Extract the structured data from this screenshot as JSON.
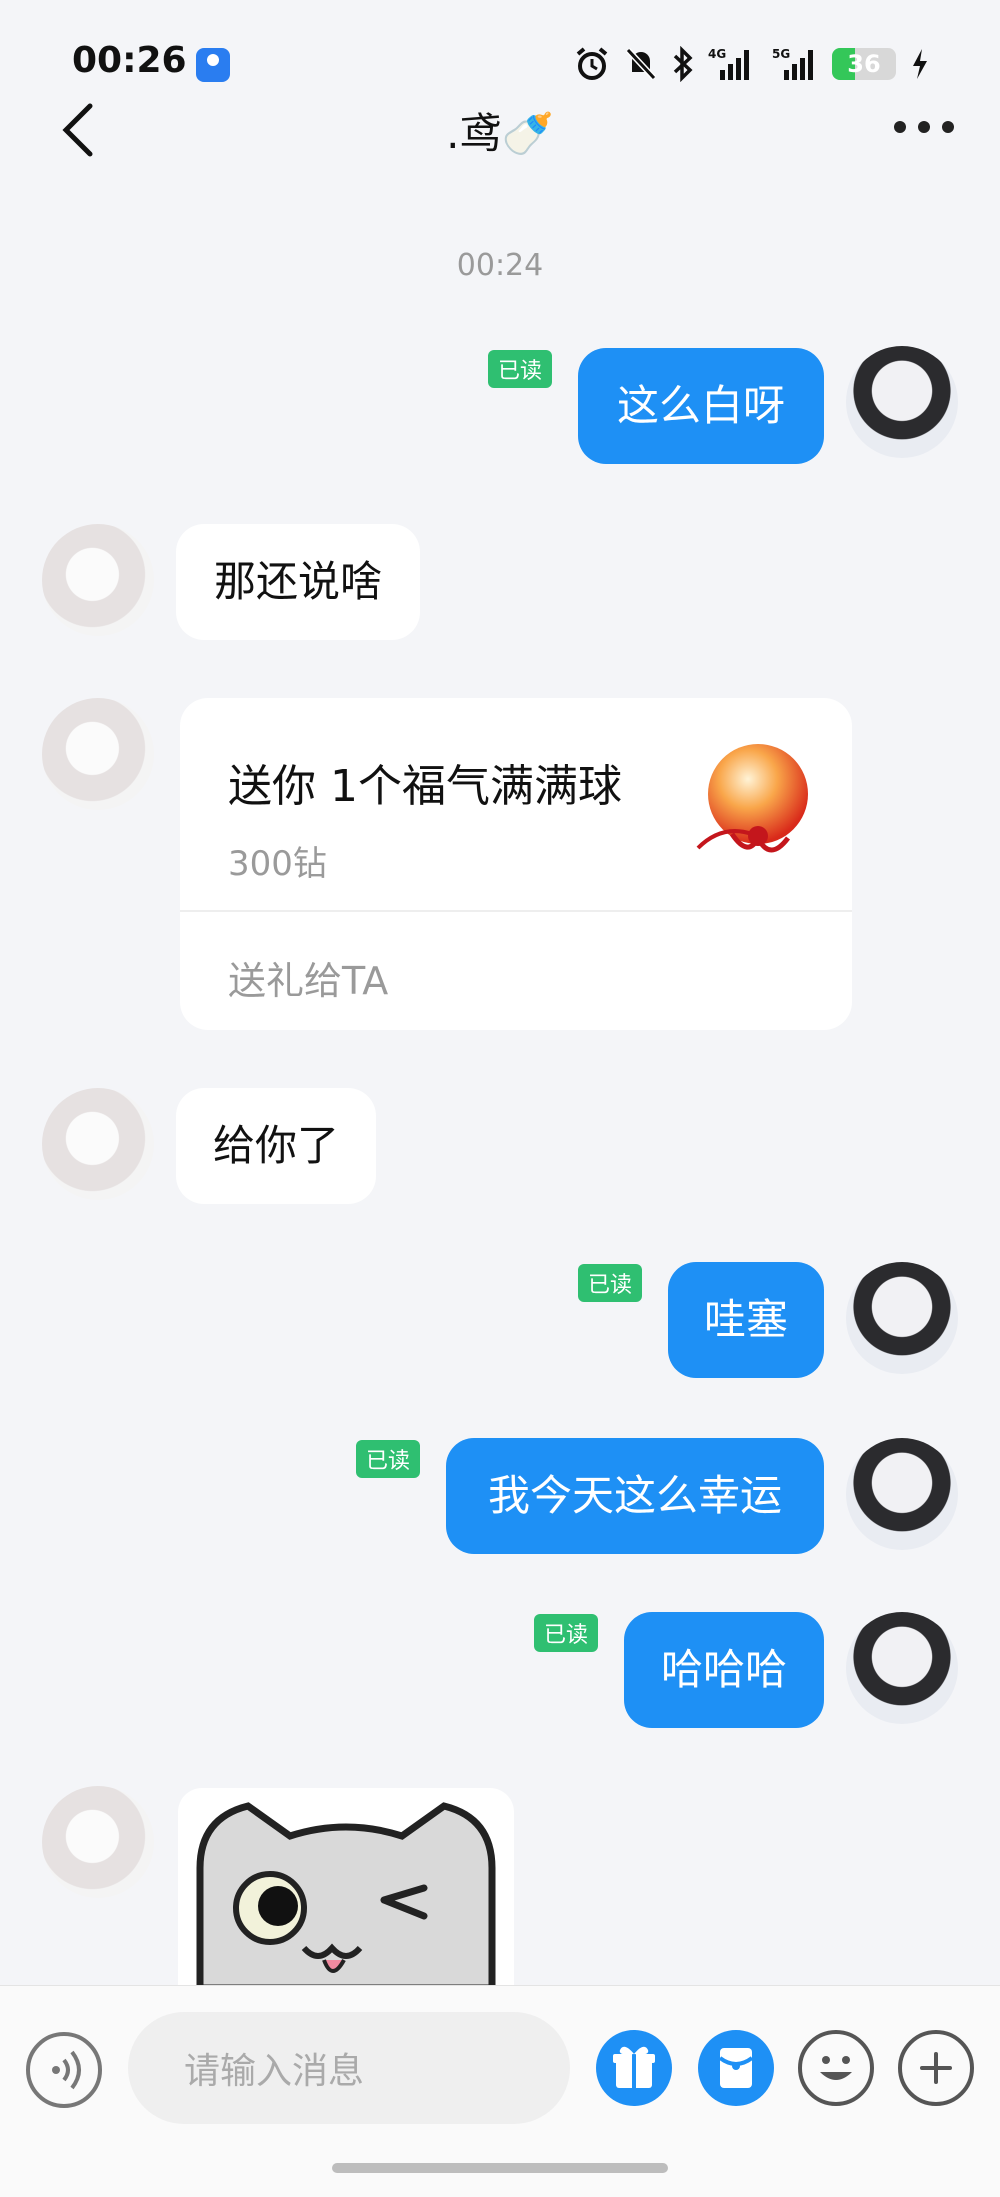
{
  "status_bar": {
    "time": "00:26",
    "battery": "36",
    "network_labels": [
      "4G",
      "5G"
    ]
  },
  "header": {
    "title": ".鸢🍼"
  },
  "timestamp": "00:24",
  "messages": [
    {
      "from": "me",
      "text": "这么白呀",
      "read": "已读"
    },
    {
      "from": "other",
      "text": "那还说啥"
    },
    {
      "from": "other",
      "type": "gift",
      "gift_title": "送你 1个福气满满球",
      "gift_price": "300钻",
      "gift_action": "送礼给TA"
    },
    {
      "from": "other",
      "text": "给你了"
    },
    {
      "from": "me",
      "text": "哇塞",
      "read": "已读"
    },
    {
      "from": "me",
      "text": "我今天这么幸运",
      "read": "已读"
    },
    {
      "from": "me",
      "text": "哈哈哈",
      "read": "已读"
    },
    {
      "from": "other",
      "type": "sticker",
      "sticker": "winking-cat-sticker"
    }
  ],
  "input": {
    "placeholder": "请输入消息"
  },
  "colors": {
    "accent": "#1e90f5",
    "read_badge": "#2fbf71",
    "background": "#f4f5f8"
  }
}
